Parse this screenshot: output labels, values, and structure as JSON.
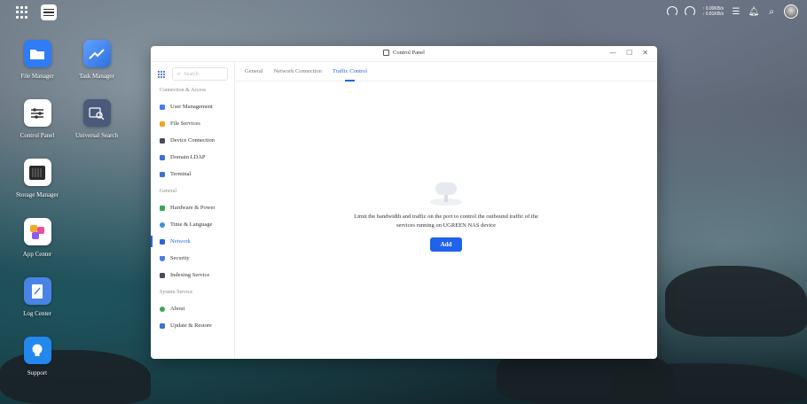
{
  "topbar": {
    "upload_speed": "↑ 0.00KB/s",
    "download_speed": "↓ 0.81KB/s"
  },
  "desktop": {
    "icons": [
      {
        "label": "File Manager",
        "color": "#2f7cf6",
        "icon": "folder-icon"
      },
      {
        "label": "Task Manager",
        "color": "#3f86f0",
        "icon": "chart-trend-icon"
      },
      {
        "label": "Control Panel",
        "color": "#ffffff",
        "icon": "sliders-icon"
      },
      {
        "label": "Universal Search",
        "color": "#4b5a7a",
        "icon": "search-doc-icon"
      },
      {
        "label": "Storage Manager",
        "color": "#ffffff",
        "icon": "disk-icon"
      },
      {
        "label": "App Center",
        "color": "#ffffff",
        "icon": "apps-icon"
      },
      {
        "label": "Log Center",
        "color": "#4a83e6",
        "icon": "log-icon"
      },
      {
        "label": "Support",
        "color": "#2288ee",
        "icon": "bulb-icon"
      }
    ]
  },
  "window": {
    "title": "Control Panel",
    "minimize": "—",
    "maximize": "☐",
    "close": "✕"
  },
  "sidebar": {
    "search_placeholder": "Search",
    "sections": [
      {
        "label": "Connection & Access"
      },
      {
        "label": "General"
      },
      {
        "label": "System Service"
      }
    ],
    "items": [
      {
        "label": "User Management",
        "color": "#4a7ee6"
      },
      {
        "label": "File Services",
        "color": "#f5a623"
      },
      {
        "label": "Device Connection",
        "color": "#4a4a5a"
      },
      {
        "label": "Domain LDAP",
        "color": "#3f6fd8"
      },
      {
        "label": "Terminal",
        "color": "#3f6fd8"
      },
      {
        "label": "Hardware & Power",
        "color": "#3aa55a"
      },
      {
        "label": "Time & Language",
        "color": "#3f8fe0"
      },
      {
        "label": "Network",
        "color": "#2a64e0"
      },
      {
        "label": "Security",
        "color": "#4a7ee6"
      },
      {
        "label": "Indexing Service",
        "color": "#4a4a5a"
      },
      {
        "label": "About",
        "color": "#3aa55a"
      },
      {
        "label": "Update & Restore",
        "color": "#3f6fd8"
      }
    ],
    "active": "Network"
  },
  "main": {
    "tabs": [
      {
        "label": "General"
      },
      {
        "label": "Network Connection"
      },
      {
        "label": "Traffic Control"
      }
    ],
    "active_tab": "Traffic Control",
    "empty_message": "Limit the bandwidth and traffic on the port to control the outbound traffic of the services running on UGREEN NAS device",
    "add_button": "Add"
  },
  "colors": {
    "accent": "#1e63e9"
  }
}
